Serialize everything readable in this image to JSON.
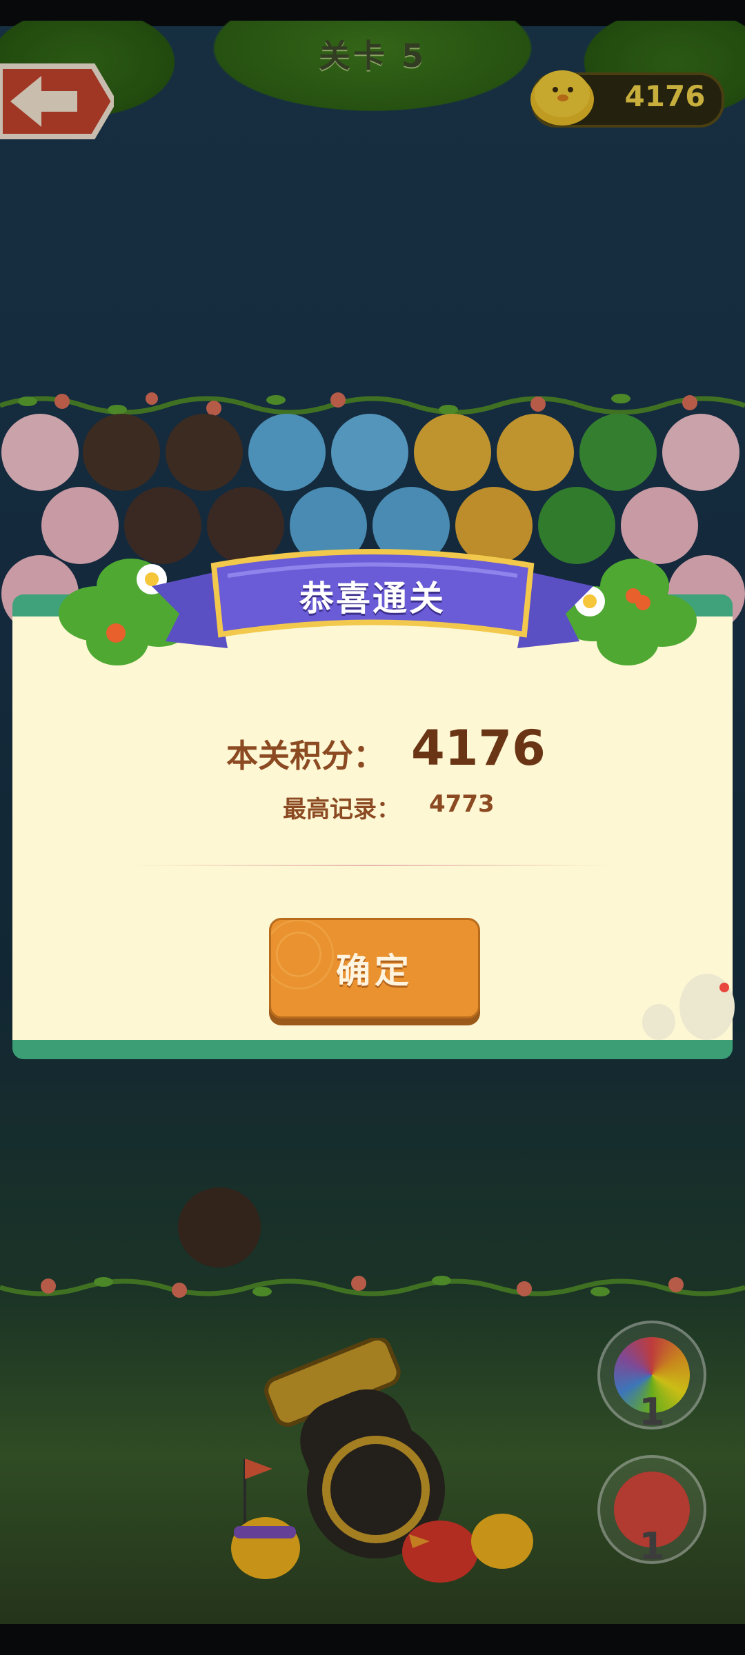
{
  "header": {
    "level_title": "关卡 5",
    "coins": "4176"
  },
  "dialog": {
    "ribbon_title": "恭喜通关",
    "score_label": "本关积分：",
    "score_value": "4176",
    "best_label": "最高记录：",
    "best_value": "4773",
    "confirm_label": "确定"
  },
  "boosters": [
    {
      "name": "rainbow-bubble",
      "count": "1"
    },
    {
      "name": "red-bomb-bubble",
      "count": "1"
    }
  ],
  "colors": {
    "panel_bg": "#fdf7d3",
    "panel_trim": "#3fa27a",
    "button": "#e9922f",
    "ribbon": "#6a5bd6",
    "text_brown": "#8b4a22"
  }
}
